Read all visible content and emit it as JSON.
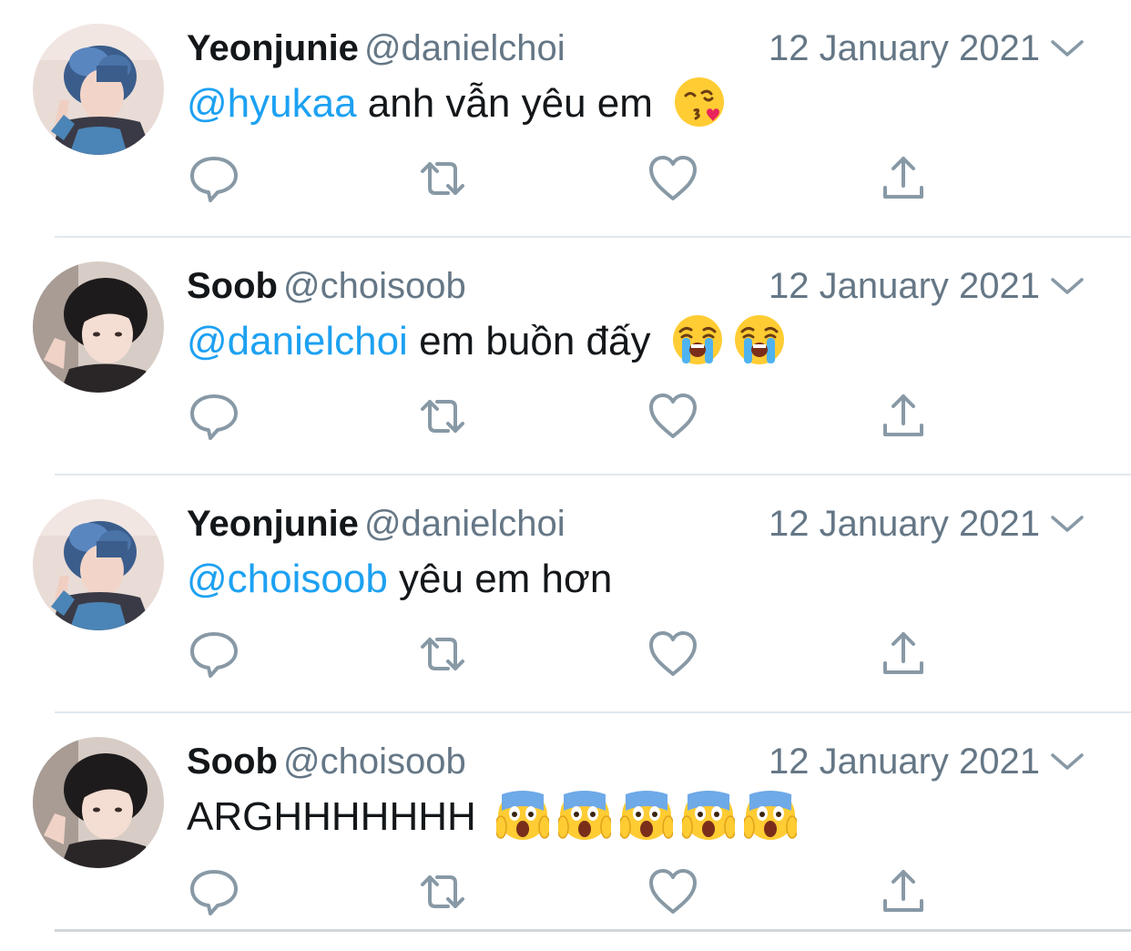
{
  "colors": {
    "mention": "#1da1f2",
    "name": "#14171a",
    "meta": "#657786",
    "icon": "#8899a6",
    "divider": "#e1e8ed"
  },
  "tweets": [
    {
      "avatar": "blue-hair-avatar",
      "name": "Yeonjunie",
      "handle": "@danielchoi",
      "date": "12 January 2021",
      "mention": "@hyukaa",
      "text": "anh vẫn yêu em",
      "emojis": [
        "kissing-heart-emoji"
      ]
    },
    {
      "avatar": "dark-hair-avatar",
      "name": "Soob",
      "handle": "@choisoob",
      "date": "12 January 2021",
      "mention": "@danielchoi",
      "text": "em buồn đấy",
      "emojis": [
        "crying-emoji",
        "crying-emoji"
      ]
    },
    {
      "avatar": "blue-hair-avatar",
      "name": "Yeonjunie",
      "handle": "@danielchoi",
      "date": "12 January 2021",
      "mention": "@choisoob",
      "text": "yêu em hơn",
      "emojis": []
    },
    {
      "avatar": "dark-hair-avatar",
      "name": "Soob",
      "handle": "@choisoob",
      "date": "12 January 2021",
      "mention": "",
      "text": "ARGHHHHHHH",
      "emojis": [
        "screaming-emoji",
        "screaming-emoji",
        "screaming-emoji",
        "screaming-emoji",
        "screaming-emoji"
      ]
    }
  ],
  "actions": [
    "reply-icon",
    "retweet-icon",
    "like-icon",
    "share-icon"
  ]
}
